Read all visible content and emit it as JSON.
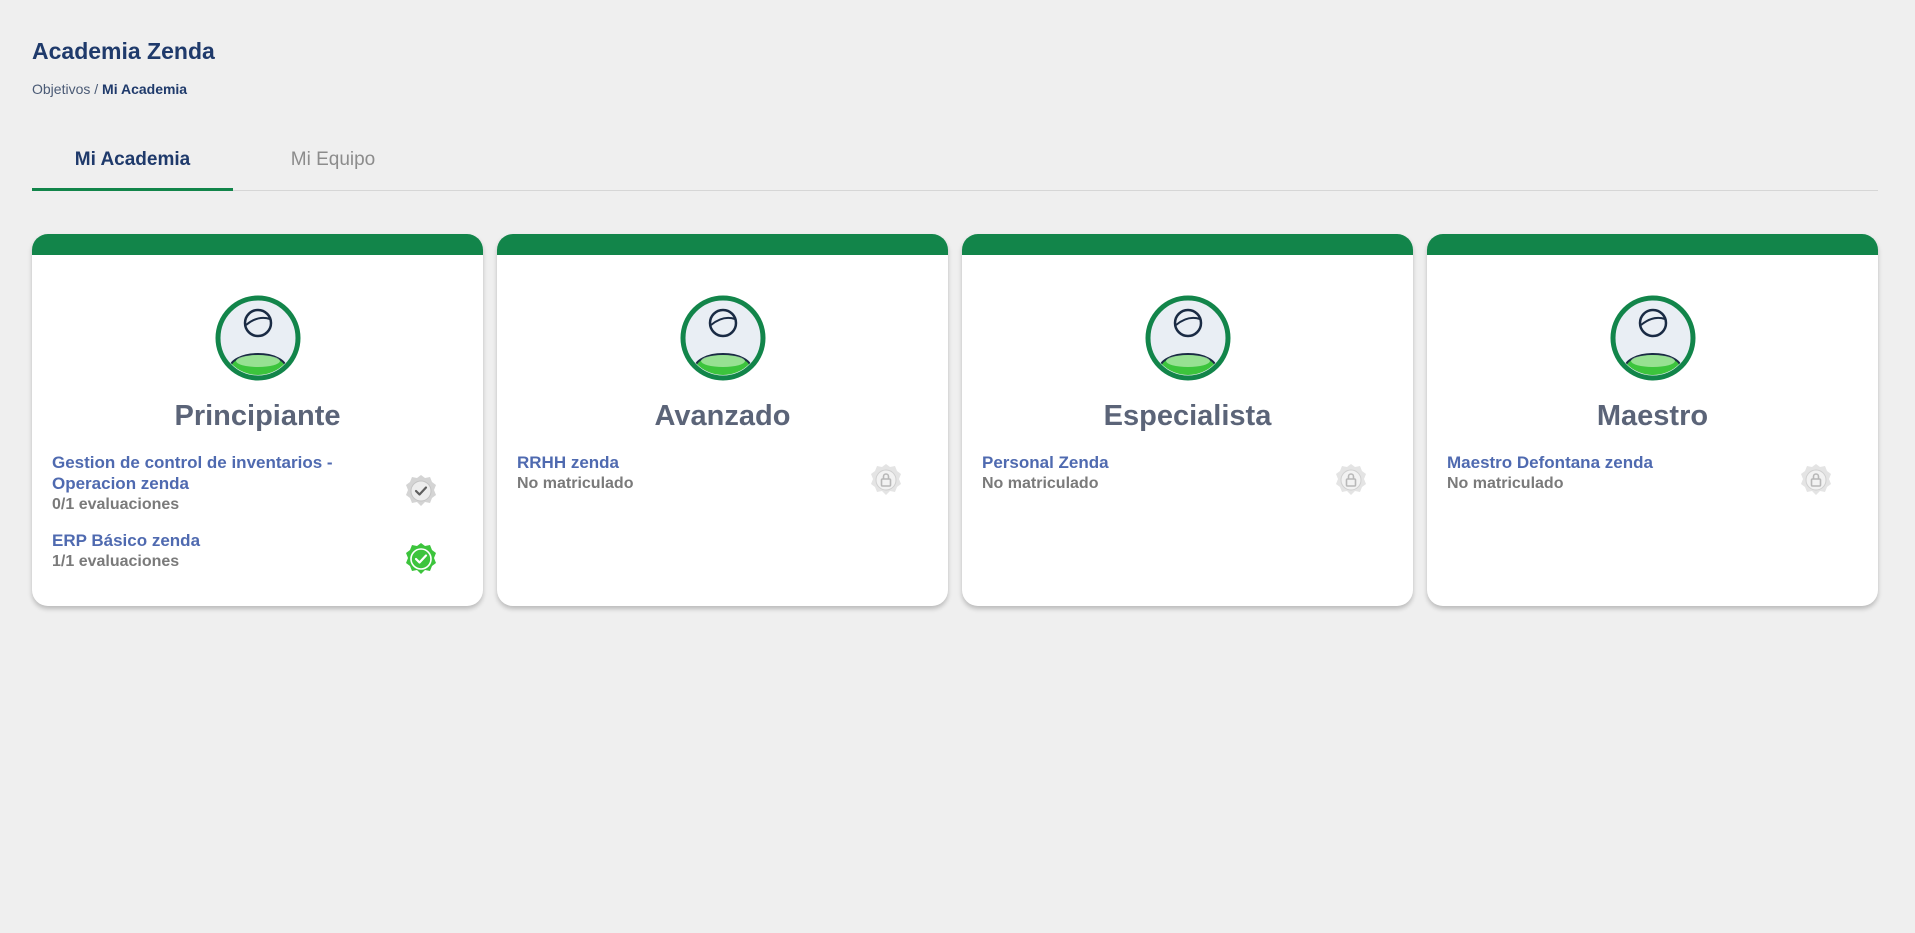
{
  "header": {
    "title": "Academia Zenda",
    "breadcrumb": {
      "parent": "Objetivos",
      "separator": " / ",
      "current": "Mi Academia"
    }
  },
  "tabs": [
    {
      "label": "Mi Academia",
      "active": true
    },
    {
      "label": "Mi Equipo",
      "active": false
    }
  ],
  "colors": {
    "brand_green": "#12854a",
    "title_navy": "#1f3a6b",
    "link_blue": "#4f6ab0",
    "success_green": "#3cc43c"
  },
  "levels": [
    {
      "title": "Principiante",
      "icon": "user-avatar-icon",
      "courses": [
        {
          "name": "Gestion de control de inventarios - Operacion zenda",
          "status": "0/1 evaluaciones",
          "badge": "check-badge-grey-icon"
        },
        {
          "name": "ERP Básico zenda",
          "status": "1/1 evaluaciones",
          "badge": "check-badge-green-icon"
        }
      ]
    },
    {
      "title": "Avanzado",
      "icon": "user-avatar-icon",
      "courses": [
        {
          "name": "RRHH zenda",
          "status": "No matriculado",
          "badge": "lock-badge-icon"
        }
      ]
    },
    {
      "title": "Especialista",
      "icon": "user-avatar-icon",
      "courses": [
        {
          "name": "Personal Zenda",
          "status": "No matriculado",
          "badge": "lock-badge-icon"
        }
      ]
    },
    {
      "title": "Maestro",
      "icon": "user-avatar-icon",
      "courses": [
        {
          "name": "Maestro Defontana zenda",
          "status": "No matriculado",
          "badge": "lock-badge-icon"
        }
      ]
    }
  ]
}
